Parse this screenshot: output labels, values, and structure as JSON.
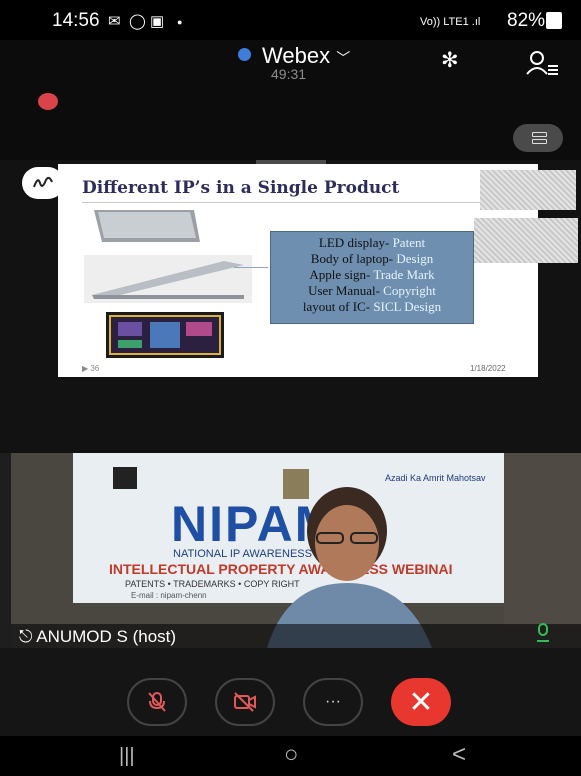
{
  "status_bar": {
    "time": "14:56",
    "icons": [
      "mail-icon",
      "whatsapp-icon",
      "image-icon",
      "dot-icon"
    ],
    "network": "Vo)) LTE1 .ıl",
    "battery": "82%"
  },
  "header": {
    "app_name": "Webex",
    "timer": "49:31"
  },
  "slide": {
    "title": "Different IP’s in a Single Product",
    "items": [
      {
        "label": "LED display- ",
        "type": "Patent"
      },
      {
        "label": "Body of laptop- ",
        "type": "Design"
      },
      {
        "label": "Apple sign- ",
        "type": "Trade Mark"
      },
      {
        "label": "User Manual- ",
        "type": "Copyright"
      },
      {
        "label": "layout of IC- ",
        "type": "SICL Design"
      }
    ],
    "number": "36",
    "date": "1/18/2022"
  },
  "video": {
    "banner_logo": "NIPAM",
    "banner_sub": "NATIONAL IP AWARENESS MISSION",
    "banner_line": "INTELLECTUAL PROPERTY AWARENESS WEBINAI",
    "banner_small": "PATENTS • TRADEMARKS • COPY RIGHT",
    "banner_email": "E-mail : nipam-chenn",
    "banner_badge": "Azadi Ka Amrit Mahotsav",
    "host_label": "ANUMOD S (host)"
  },
  "colors": {
    "accent": "#3d7fd8",
    "end_call": "#e7372f",
    "muted": "#d9444a",
    "speaking": "#2fbf5a"
  },
  "nav": {
    "recents": "|||",
    "home": "○",
    "back": "<"
  },
  "more_label": "···",
  "end_label": "✕"
}
